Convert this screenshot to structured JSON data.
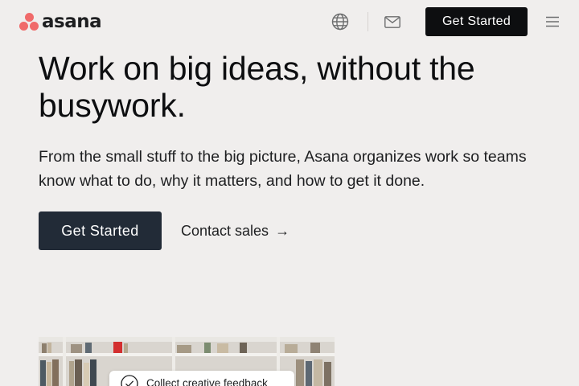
{
  "brand": {
    "name": "asana",
    "logo_color": "#f06a6a"
  },
  "nav": {
    "language_icon": "globe-icon",
    "contact_icon": "mail-icon",
    "cta_label": "Get Started",
    "menu_icon": "hamburger-menu-icon"
  },
  "hero": {
    "headline": "Work on big ideas, without the busywork.",
    "subtext": "From the small stuff to the big picture, Asana organizes work so teams know what to do, why it matters, and how to get it done.",
    "primary_cta": "Get Started",
    "secondary_cta": "Contact sales",
    "secondary_cta_icon": "arrow-right-icon"
  },
  "media": {
    "task_card": {
      "label": "Collect creative feedback",
      "icon": "check-circle-icon"
    }
  },
  "colors": {
    "background": "#f0eeed",
    "nav_button": "#0d0e10",
    "hero_button": "#222b37",
    "text": "#1e1f21"
  }
}
